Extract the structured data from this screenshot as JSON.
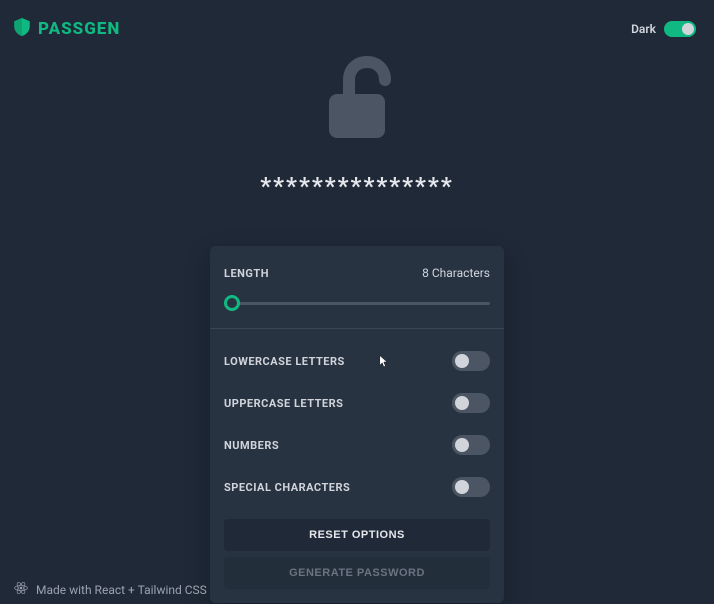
{
  "brand": {
    "name": "PASSGEN"
  },
  "theme": {
    "label": "Dark",
    "on": true
  },
  "password_display": "***************",
  "panel": {
    "length_label": "LENGTH",
    "length_value": "8 Characters",
    "options": {
      "lowercase": {
        "label": "LOWERCASE LETTERS",
        "on": false
      },
      "uppercase": {
        "label": "UPPERCASE LETTERS",
        "on": false
      },
      "numbers": {
        "label": "NUMBERS",
        "on": false
      },
      "special": {
        "label": "SPECIAL CHARACTERS",
        "on": false
      }
    },
    "reset_label": "RESET OPTIONS",
    "generate_label": "GENERATE PASSWORD"
  },
  "footer": {
    "text": "Made with React + Tailwind CSS"
  }
}
